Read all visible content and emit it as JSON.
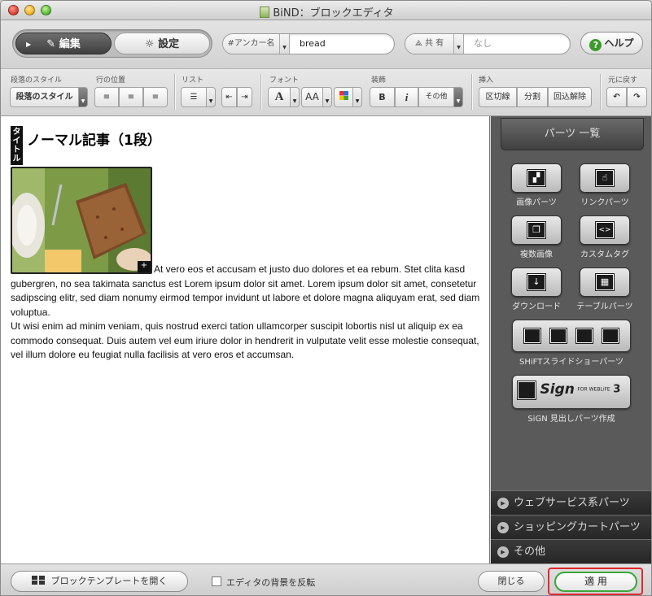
{
  "window": {
    "title": "BiND：ブロックエディタ"
  },
  "mode": {
    "edit_label": "編集",
    "settings_label": "設定"
  },
  "anchor": {
    "label": "#アンカー名",
    "value": "bread"
  },
  "share": {
    "label": "共 有",
    "value": "なし"
  },
  "help_label": "ヘルプ",
  "format_toolbar": {
    "paragraph_style": {
      "group": "段落のスタイル",
      "button": "段落のスタイル"
    },
    "line_position": {
      "group": "行の位置"
    },
    "list": {
      "group": "リスト"
    },
    "font": {
      "group": "フォント",
      "size_glyph": "AA",
      "face_glyph": "A"
    },
    "decoration": {
      "group": "装飾",
      "bold": "B",
      "italic": "i",
      "other": "その他"
    },
    "insert": {
      "group": "挿入",
      "divider": "区切線",
      "split": "分割",
      "wrap_remove": "回込解除"
    },
    "undo": {
      "group": "元に戻す"
    }
  },
  "editor": {
    "title_tag": "タイトル",
    "article_title": "ノーマル記事（1段）",
    "paragraph1": "At vero eos et accusam et justo duo dolores et ea rebum. Stet clita kasd gubergren, no sea takimata sanctus est Lorem ipsum dolor sit amet. Lorem ipsum dolor sit amet, consetetur sadipscing elitr, sed diam nonumy eirmod tempor invidunt ut labore et dolore magna aliquyam erat, sed diam voluptua.",
    "paragraph2": "Ut wisi enim ad minim veniam, quis nostrud exerci tation ullamcorper suscipit lobortis nisl ut aliquip ex ea commodo consequat. Duis autem vel eum iriure dolor in hendrerit in vulputate velit esse molestie consequat, vel illum dolore eu feugiat nulla facilisis at vero eros et accumsan."
  },
  "parts_panel": {
    "header": "パーツ 一覧",
    "items": [
      {
        "label": "画像パーツ",
        "icon": "image-icon"
      },
      {
        "label": "リンクパーツ",
        "icon": "link-hand-icon"
      },
      {
        "label": "複数画像",
        "icon": "multi-image-icon"
      },
      {
        "label": "カスタムタグ",
        "icon": "custom-tag-icon"
      },
      {
        "label": "ダウンロード",
        "icon": "download-icon"
      },
      {
        "label": "テーブルパーツ",
        "icon": "table-icon"
      },
      {
        "label": "SHiFTスライドショーパーツ",
        "icon": "slideshow-icon"
      },
      {
        "label": "SiGN 見出しパーツ作成",
        "icon": "sign-logo-icon"
      }
    ],
    "sign_logo_text": "Sign",
    "sign_logo_sub": "FOR WEBLiFE",
    "sign_logo_num": "3",
    "sections": [
      {
        "label": "ウェブサービス系パーツ"
      },
      {
        "label": "ショッピングカートパーツ"
      },
      {
        "label": "その他"
      }
    ]
  },
  "footer": {
    "open_template": "ブロックテンプレートを開く",
    "invert_bg": "エディタの背景を反転",
    "close": "閉じる",
    "apply": "適 用"
  },
  "colors": {
    "apply_highlight": "#e0292f",
    "apply_border": "#3aa63a",
    "help_icon": "#3b9b2a"
  }
}
